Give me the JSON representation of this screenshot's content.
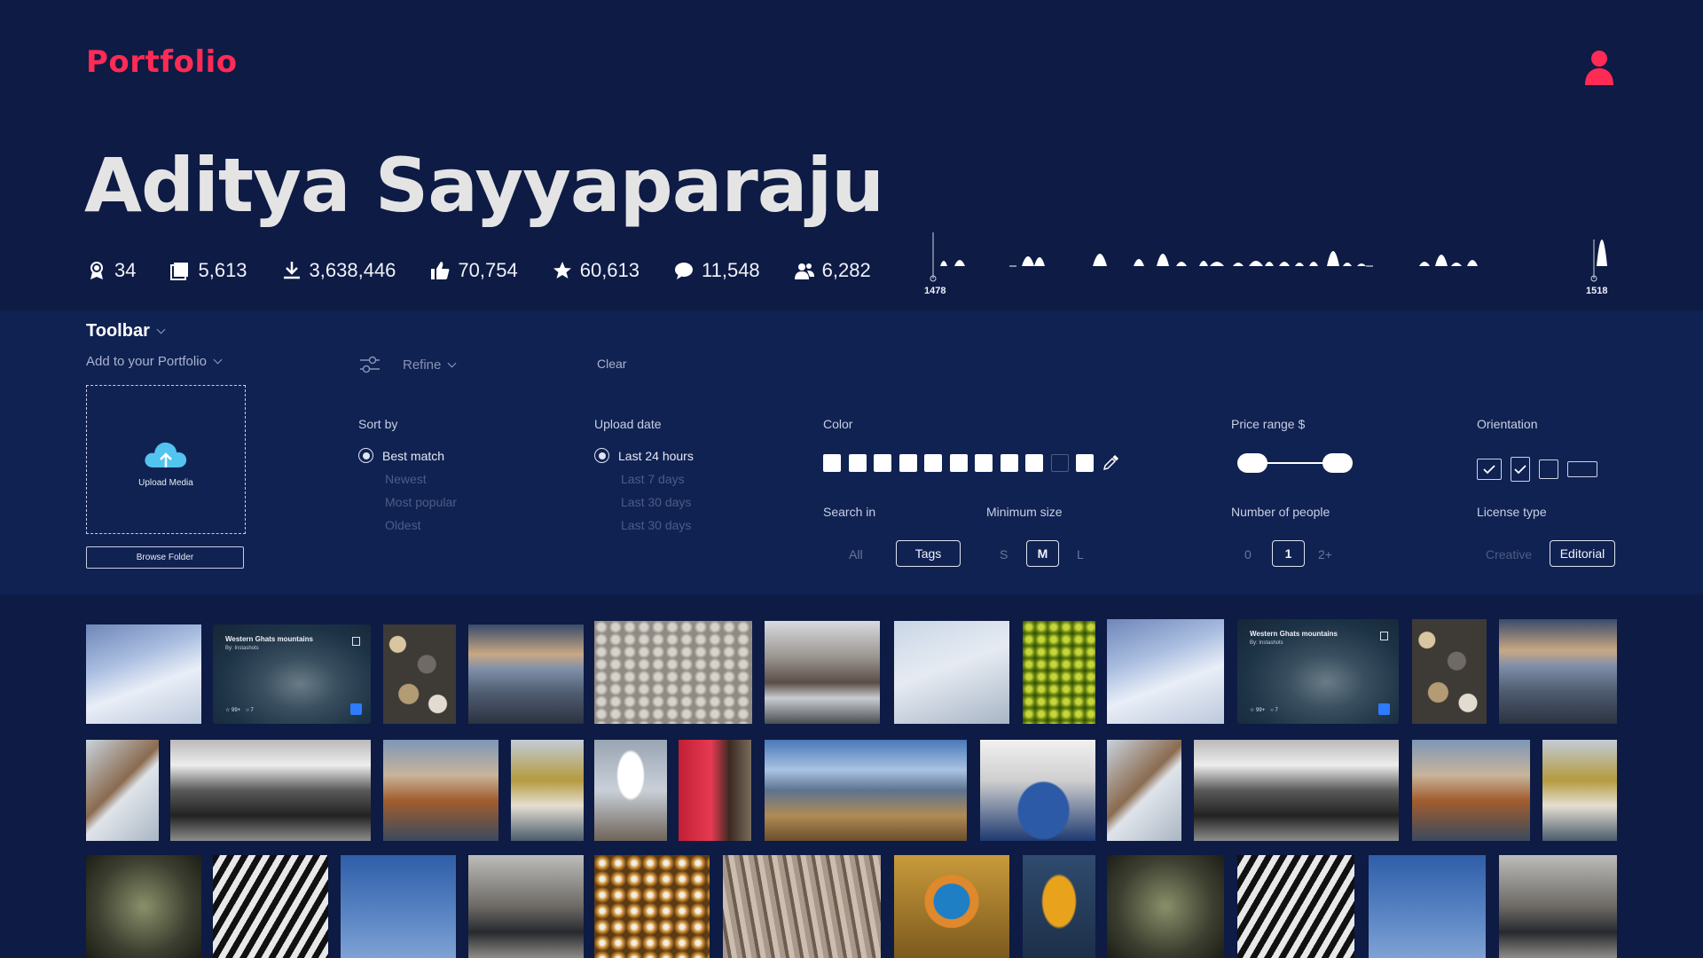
{
  "header": {
    "logo": "Portfolio",
    "user_icon": "user-icon"
  },
  "profile": {
    "name": "Aditya Sayyaparaju",
    "stats": [
      {
        "icon": "badge-icon",
        "value": "34"
      },
      {
        "icon": "photos-icon",
        "value": "5,613"
      },
      {
        "icon": "download-icon",
        "value": "3,638,446"
      },
      {
        "icon": "thumbs-up-icon",
        "value": "70,754"
      },
      {
        "icon": "star-icon",
        "value": "60,613"
      },
      {
        "icon": "comment-icon",
        "value": "11,548"
      },
      {
        "icon": "followers-icon",
        "value": "6,282"
      }
    ],
    "activity": {
      "start_label": "1478",
      "end_label": "1518"
    }
  },
  "toolbar": {
    "title": "Toolbar",
    "add_to_portfolio": "Add to your Portfolio",
    "upload_label": "Upload Media",
    "browse_label": "Browse Folder",
    "refine_label": "Refine",
    "clear_label": "Clear",
    "sort": {
      "title": "Sort by",
      "options": [
        "Best match",
        "Newest",
        "Most popular",
        "Oldest"
      ],
      "selected": "Best match"
    },
    "upload_date": {
      "title": "Upload date",
      "options": [
        "Last 24 hours",
        "Last 7 days",
        "Last 30 days",
        "Last 30 days"
      ],
      "selected": "Last 24 hours"
    },
    "color": {
      "title": "Color",
      "swatch_colors": [
        "#ffffff",
        "#ffffff",
        "#ffffff",
        "#ffffff",
        "#ffffff",
        "#ffffff",
        "#ffffff",
        "#ffffff",
        "#ffffff",
        "#102252",
        "#ffffff"
      ]
    },
    "search_in": {
      "title": "Search in",
      "options": [
        "All",
        "Tags"
      ],
      "selected": "Tags"
    },
    "min_size": {
      "title": "Minimum size",
      "options": [
        "S",
        "M",
        "L"
      ],
      "selected": "M"
    },
    "price": {
      "title": "Price range $"
    },
    "people": {
      "title": "Number of people",
      "options": [
        "0",
        "1",
        "2+"
      ],
      "selected": "1"
    },
    "orientation": {
      "title": "Orientation"
    },
    "license": {
      "title": "License type",
      "options": [
        "Creative",
        "Editorial"
      ],
      "selected": "Editorial"
    }
  },
  "gallery": {
    "card": {
      "title": "Western Ghats mountains",
      "byline": "By: Instashots",
      "likes": "99+",
      "comments": "7"
    },
    "items": [
      "snowy-mountain-hiker",
      "western-ghats-card",
      "colorful-pebbles",
      "rocky-shore-sunset",
      "white-pebbles",
      "snowy-forest-road",
      "frosted-branches",
      "green-moss",
      "snowy-mountain-hiker",
      "western-ghats-card",
      "colorful-pebbles",
      "rocky-shore-sunset",
      "hanging-insect",
      "black-white-landscape",
      "autumn-lake",
      "lakeside-house",
      "snow-bud",
      "red-hood",
      "panorama-beach",
      "eagle-portrait",
      "hanging-insect",
      "black-white-landscape",
      "autumn-lake",
      "lakeside-house",
      "spider-web",
      "zebra",
      "seagull-sky",
      "lizard-rocks",
      "autumn-leaves",
      "tree-bark",
      "kingfisher",
      "yellow-leaf",
      "spider-web",
      "zebra",
      "seagull-sky",
      "lizard-rocks"
    ]
  }
}
